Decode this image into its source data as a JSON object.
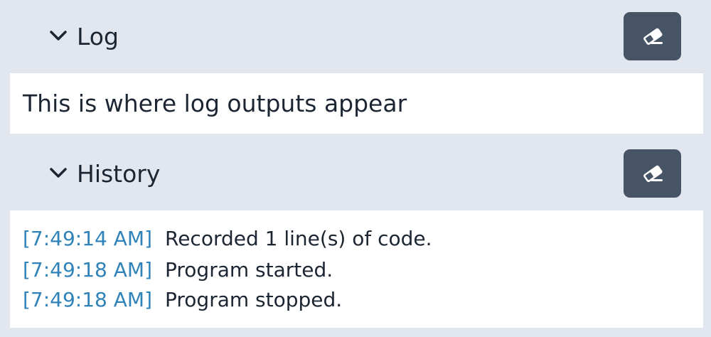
{
  "log": {
    "title": "Log",
    "body_text": "This is where log outputs appear",
    "clear_icon": "eraser-icon",
    "toggle_icon": "chevron-down-icon"
  },
  "history": {
    "title": "History",
    "clear_icon": "eraser-icon",
    "toggle_icon": "chevron-down-icon",
    "entries": [
      {
        "time": "[7:49:14 AM]",
        "message": "Recorded 1 line(s) of code."
      },
      {
        "time": "[7:49:18 AM]",
        "message": "Program started."
      },
      {
        "time": "[7:49:18 AM]",
        "message": "Program stopped."
      }
    ]
  },
  "colors": {
    "header_bg": "#e2e7ef",
    "body_bg": "#ffffff",
    "button_bg": "#475466",
    "timestamp": "#2f83b8",
    "text": "#1c2633"
  }
}
